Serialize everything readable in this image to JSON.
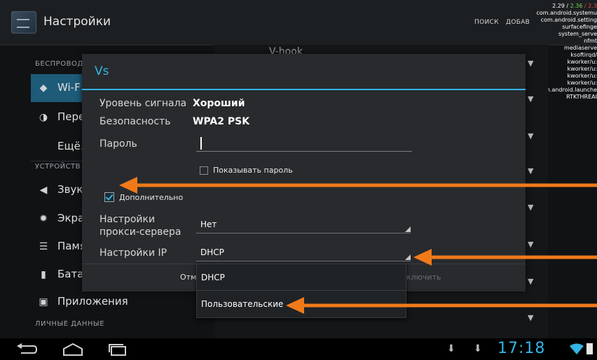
{
  "action_bar": {
    "title": "Настройки",
    "search": "ПОИСК",
    "add": "ДОБАВ"
  },
  "cpu_overlay": {
    "load_a": "2.29 /",
    "load_b": " 2.36 ",
    "load_c": "/ 2.3",
    "processes": [
      "com.android.systemu",
      "com.android.setting",
      "surfacefinge",
      "system_serve",
      "nfmt",
      "mediaserve",
      "ksoftirqd/",
      "kworker/u:",
      "kworker/u:",
      "kworker/u:",
      "kworker/u:",
      "com.android.launche",
      "RTKTHREAI"
    ]
  },
  "left_menu": {
    "section_wireless": "БЕСПРОВОД",
    "wifi": "Wi-F",
    "transfer": "Пере",
    "more": "Ещё.",
    "section_device": "УСТРОЙСТВ",
    "sound": "Звук",
    "screen": "Экра",
    "memory": "Памя",
    "battery": "Бата",
    "apps": "Приложения",
    "section_personal": "ЛИЧНЫЕ ДАННЫЕ"
  },
  "right_pane": {
    "partial_top": "V-hook"
  },
  "dialog": {
    "title": "Vs",
    "signal_label": "Уровень сигнала",
    "signal_value": "Хороший",
    "security_label": "Безопасность",
    "security_value": "WPA2 PSK",
    "password_label": "Пароль",
    "password_value": "",
    "show_password_label": "Показывать пароль",
    "show_password_checked": false,
    "advanced_label": "Дополнительно",
    "advanced_checked": true,
    "proxy_label_1": "Настройки",
    "proxy_label_2": "прокси-сервера",
    "proxy_value": "Нет",
    "ip_label": "Настройки IP",
    "ip_value": "DHCP",
    "cancel_button": "Отм",
    "connect_button": "ключить"
  },
  "dropdown": {
    "options": [
      "DHCP",
      "Пользовательские"
    ],
    "selected": "DHCP"
  },
  "status": {
    "time": "17:18"
  },
  "colors": {
    "accent": "#33b5e5",
    "arrow": "#f07a1a"
  }
}
